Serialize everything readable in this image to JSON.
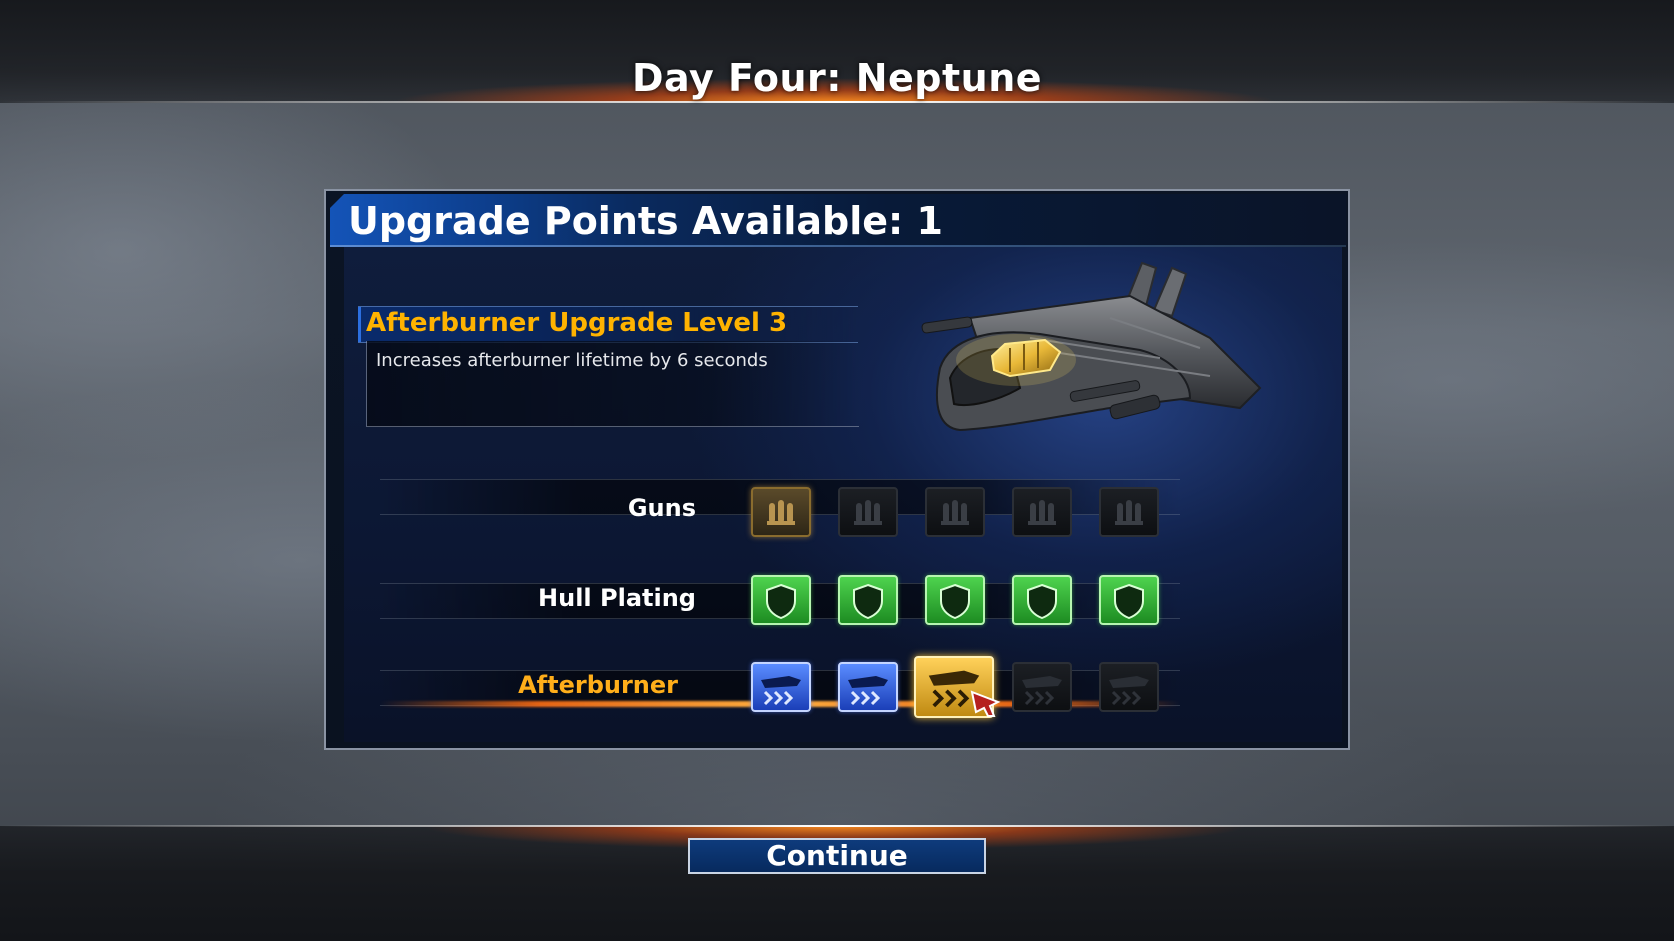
{
  "header": {
    "title": "Day Four: Neptune"
  },
  "panel": {
    "upgrade_points_label": "Upgrade Points Available: 1"
  },
  "info": {
    "title": "Afterburner Upgrade Level 3",
    "description": "Increases afterburner lifetime by 6 seconds"
  },
  "rows": [
    {
      "label": "Guns",
      "max": 5,
      "owned": 1,
      "selected": false
    },
    {
      "label": "Hull Plating",
      "max": 5,
      "owned": 5,
      "selected": false
    },
    {
      "label": "Afterburner",
      "max": 5,
      "owned": 2,
      "selected": true,
      "pending_level": 3
    }
  ],
  "colors": {
    "accent_orange": "#ffb300",
    "hull_green": "#3cc83c",
    "afterburner_blue": "#3a6cf0",
    "selected_gold": "#f5c23a"
  },
  "footer": {
    "continue_label": "Continue"
  }
}
